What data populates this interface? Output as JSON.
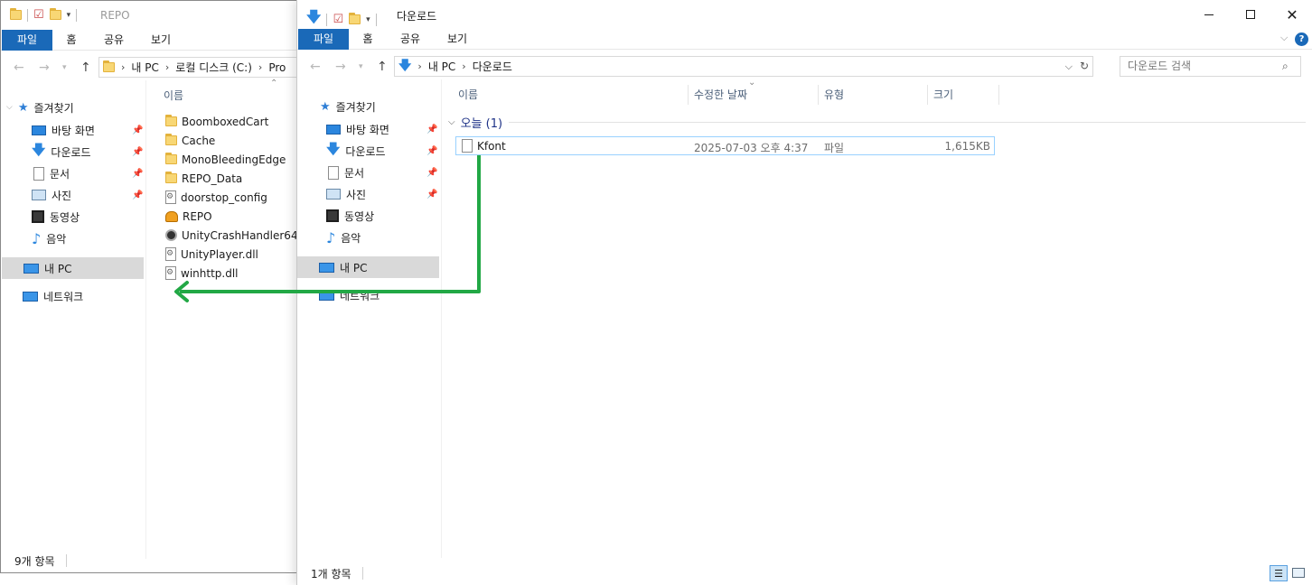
{
  "left_window": {
    "title": "REPO",
    "ribbon_tabs": [
      "파일",
      "홈",
      "공유",
      "보기"
    ],
    "breadcrumbs": [
      "내 PC",
      "로컬 디스크 (C:)",
      "Pro"
    ],
    "nav": {
      "quick_access": "즐겨찾기",
      "items": [
        {
          "label": "바탕 화면",
          "icon": "desktop-icon",
          "pinned": true
        },
        {
          "label": "다운로드",
          "icon": "download-icon",
          "pinned": true
        },
        {
          "label": "문서",
          "icon": "document-icon",
          "pinned": true
        },
        {
          "label": "사진",
          "icon": "pictures-icon",
          "pinned": true
        },
        {
          "label": "동영상",
          "icon": "video-icon",
          "pinned": false
        },
        {
          "label": "음악",
          "icon": "music-icon",
          "pinned": false
        }
      ],
      "this_pc": "내 PC",
      "network": "네트워크"
    },
    "column_name": "이름",
    "files": [
      {
        "name": "BoomboxedCart",
        "icon": "folder-icon"
      },
      {
        "name": "Cache",
        "icon": "folder-icon"
      },
      {
        "name": "MonoBleedingEdge",
        "icon": "folder-icon"
      },
      {
        "name": "REPO_Data",
        "icon": "folder-icon"
      },
      {
        "name": "doorstop_config",
        "icon": "config-file-icon"
      },
      {
        "name": "REPO",
        "icon": "app-icon"
      },
      {
        "name": "UnityCrashHandler64",
        "icon": "unity-icon"
      },
      {
        "name": "UnityPlayer.dll",
        "icon": "dll-icon"
      },
      {
        "name": "winhttp.dll",
        "icon": "dll-icon"
      }
    ],
    "status": "9개 항목"
  },
  "right_window": {
    "title": "다운로드",
    "ribbon_tabs": [
      "파일",
      "홈",
      "공유",
      "보기"
    ],
    "breadcrumbs": [
      "내 PC",
      "다운로드"
    ],
    "search_placeholder": "다운로드 검색",
    "nav": {
      "quick_access": "즐겨찾기",
      "items": [
        {
          "label": "바탕 화면",
          "icon": "desktop-icon",
          "pinned": true
        },
        {
          "label": "다운로드",
          "icon": "download-icon",
          "pinned": true
        },
        {
          "label": "문서",
          "icon": "document-icon",
          "pinned": true
        },
        {
          "label": "사진",
          "icon": "pictures-icon",
          "pinned": true
        },
        {
          "label": "동영상",
          "icon": "video-icon",
          "pinned": false
        },
        {
          "label": "음악",
          "icon": "music-icon",
          "pinned": false
        }
      ],
      "this_pc": "내 PC",
      "network": "네트워크"
    },
    "columns": [
      "이름",
      "수정한 날짜",
      "유형",
      "크기"
    ],
    "group_label": "오늘 (1)",
    "files": [
      {
        "name": "Kfont",
        "date": "2025-07-03 오후 4:37",
        "type": "파일",
        "size": "1,615KB"
      }
    ],
    "status": "1개 항목"
  },
  "colors": {
    "accent": "#1a69b8",
    "arrow": "#22a845",
    "folder": "#f8d775",
    "selection": "#d9d9d9"
  }
}
